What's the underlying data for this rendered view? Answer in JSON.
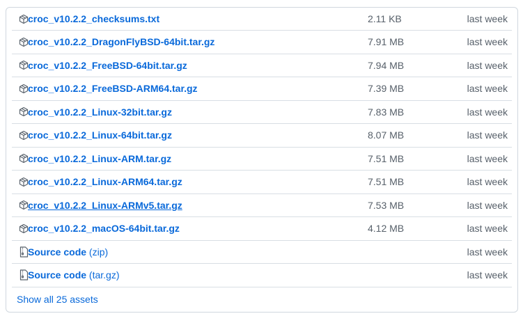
{
  "assets": [
    {
      "name": "croc_v10.2.2_checksums.txt",
      "size": "2.11 KB",
      "date": "last week",
      "icon": "package-icon"
    },
    {
      "name": "croc_v10.2.2_DragonFlyBSD-64bit.tar.gz",
      "size": "7.91 MB",
      "date": "last week",
      "icon": "package-icon"
    },
    {
      "name": "croc_v10.2.2_FreeBSD-64bit.tar.gz",
      "size": "7.94 MB",
      "date": "last week",
      "icon": "package-icon"
    },
    {
      "name": "croc_v10.2.2_FreeBSD-ARM64.tar.gz",
      "size": "7.39 MB",
      "date": "last week",
      "icon": "package-icon"
    },
    {
      "name": "croc_v10.2.2_Linux-32bit.tar.gz",
      "size": "7.83 MB",
      "date": "last week",
      "icon": "package-icon"
    },
    {
      "name": "croc_v10.2.2_Linux-64bit.tar.gz",
      "size": "8.07 MB",
      "date": "last week",
      "icon": "package-icon"
    },
    {
      "name": "croc_v10.2.2_Linux-ARM.tar.gz",
      "size": "7.51 MB",
      "date": "last week",
      "icon": "package-icon"
    },
    {
      "name": "croc_v10.2.2_Linux-ARM64.tar.gz",
      "size": "7.51 MB",
      "date": "last week",
      "icon": "package-icon"
    },
    {
      "name": "croc_v10.2.2_Linux-ARMv5.tar.gz",
      "size": "7.53 MB",
      "date": "last week",
      "icon": "package-icon",
      "hovered": true
    },
    {
      "name": "croc_v10.2.2_macOS-64bit.tar.gz",
      "size": "4.12 MB",
      "date": "last week",
      "icon": "package-icon"
    }
  ],
  "source": [
    {
      "name": "Source code",
      "suffix": "(zip)",
      "date": "last week",
      "icon": "file-zip-icon"
    },
    {
      "name": "Source code",
      "suffix": "(tar.gz)",
      "date": "last week",
      "icon": "file-zip-icon"
    }
  ],
  "footer": {
    "show_all_label": "Show all 25 assets"
  },
  "colors": {
    "link": "#0969da",
    "muted": "#57606a",
    "border": "#d0d7de"
  }
}
